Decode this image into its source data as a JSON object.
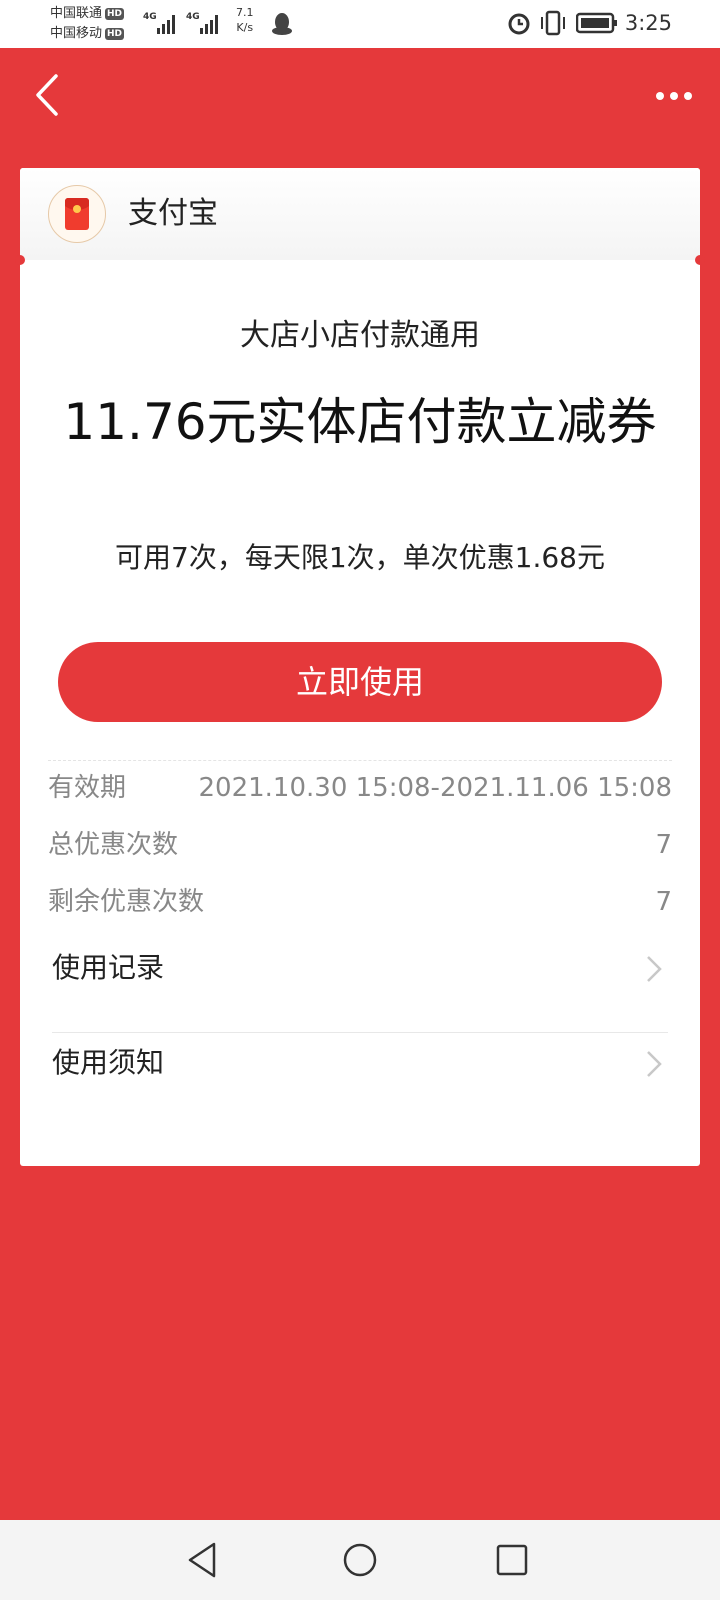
{
  "status_bar": {
    "carrier1": "中国联通",
    "carrier2": "中国移动",
    "hd_badge": "HD",
    "net1": "4G",
    "net2": "4G",
    "speed_value": "7.1",
    "speed_unit": "K/s",
    "time": "3:25",
    "icons": [
      "signal-icon",
      "qq-icon",
      "alarm-icon",
      "vibrate-icon",
      "battery-icon"
    ]
  },
  "header": {
    "back_icon": "chevron-left-icon",
    "more_icon": "more-dots-icon"
  },
  "card": {
    "brand_name": "支付宝",
    "subtitle": "大店小店付款通用",
    "title": "11.76元实体店付款立减券",
    "description": "可用7次，每天限1次，单次优惠1.68元",
    "use_button": "立即使用",
    "info": {
      "validity_label": "有效期",
      "validity_value": "2021.10.30 15:08-2021.11.06 15:08",
      "total_label": "总优惠次数",
      "total_value": "7",
      "remaining_label": "剩余优惠次数",
      "remaining_value": "7"
    },
    "links": {
      "records": "使用记录",
      "notice": "使用须知"
    }
  },
  "colors": {
    "primary": "#e5393b",
    "card_bg": "#ffffff",
    "muted_text": "#888888"
  }
}
